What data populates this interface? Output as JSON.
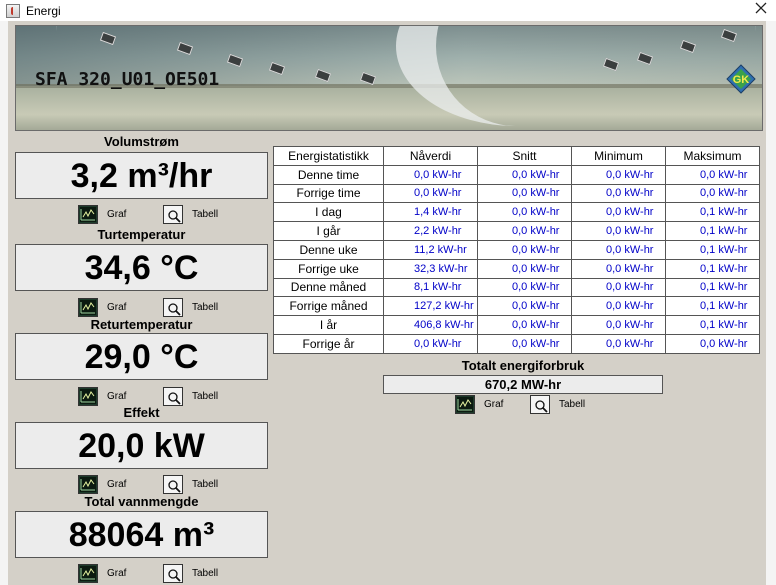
{
  "window": {
    "title": "Energi"
  },
  "banner": {
    "title": "SFA 320_U01_OE501",
    "logo_text": "GK"
  },
  "metrics": [
    {
      "label": "Volumstrøm",
      "value": "3,2 m³/hr"
    },
    {
      "label": "Turtemperatur",
      "value": "34,6 °C"
    },
    {
      "label": "Returtemperatur",
      "value": "29,0 °C"
    },
    {
      "label": "Effekt",
      "value": "20,0 kW"
    },
    {
      "label": "Total vannmengde",
      "value": "88064 m³"
    }
  ],
  "buttons": {
    "graph_label": "Graf",
    "table_label": "Tabell"
  },
  "stats": {
    "headers": [
      "Energistatistikk",
      "Nåverdi",
      "Snitt",
      "Minimum",
      "Maksimum"
    ],
    "rows": [
      {
        "label": "Denne time",
        "values": [
          "0,0 kW-hr",
          "0,0 kW-hr",
          "0,0 kW-hr",
          "0,0 kW-hr"
        ]
      },
      {
        "label": "Forrige time",
        "values": [
          "0,0 kW-hr",
          "0,0 kW-hr",
          "0,0 kW-hr",
          "0,0 kW-hr"
        ]
      },
      {
        "label": "I dag",
        "values": [
          "1,4 kW-hr",
          "0,0 kW-hr",
          "0,0 kW-hr",
          "0,1 kW-hr"
        ]
      },
      {
        "label": "I går",
        "values": [
          "2,2 kW-hr",
          "0,0 kW-hr",
          "0,0 kW-hr",
          "0,1 kW-hr"
        ]
      },
      {
        "label": "Denne uke",
        "values": [
          "11,2 kW-hr",
          "0,0 kW-hr",
          "0,0 kW-hr",
          "0,1 kW-hr"
        ]
      },
      {
        "label": "Forrige uke",
        "values": [
          "32,3 kW-hr",
          "0,0 kW-hr",
          "0,0 kW-hr",
          "0,1 kW-hr"
        ]
      },
      {
        "label": "Denne måned",
        "values": [
          "8,1 kW-hr",
          "0,0 kW-hr",
          "0,0 kW-hr",
          "0,1 kW-hr"
        ]
      },
      {
        "label": "Forrige måned",
        "values": [
          "127,2 kW-hr",
          "0,0 kW-hr",
          "0,0 kW-hr",
          "0,1 kW-hr"
        ]
      },
      {
        "label": "I år",
        "values": [
          "406,8 kW-hr",
          "0,0 kW-hr",
          "0,0 kW-hr",
          "0,1 kW-hr"
        ]
      },
      {
        "label": "Forrige år",
        "values": [
          "0,0 kW-hr",
          "0,0 kW-hr",
          "0,0 kW-hr",
          "0,0 kW-hr"
        ]
      }
    ]
  },
  "total": {
    "label": "Totalt energiforbruk",
    "value": "670,2 MW-hr"
  },
  "colors": {
    "panel": "#d4d0c8",
    "value_text": "#0000c8",
    "box": "#ececec"
  },
  "icons": {
    "graph": "graph-icon",
    "table": "magnifier-table-icon",
    "close": "close-icon"
  }
}
